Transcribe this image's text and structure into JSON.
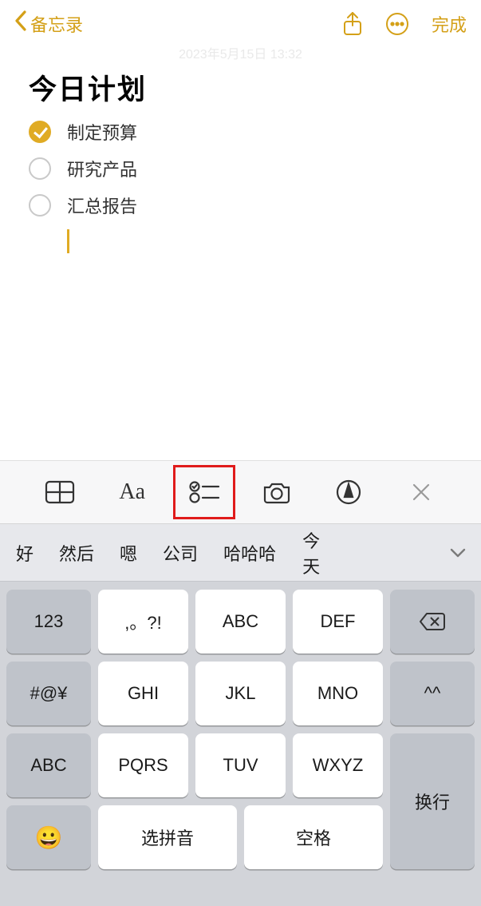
{
  "header": {
    "back_label": "备忘录",
    "done_label": "完成"
  },
  "timestamp": "2023年5月15日 13:32",
  "note": {
    "title": "今日计划",
    "items": [
      {
        "text": "制定预算",
        "checked": true
      },
      {
        "text": "研究产品",
        "checked": false
      },
      {
        "text": "汇总报告",
        "checked": false
      }
    ]
  },
  "format_bar": {
    "aa": "Aa"
  },
  "suggestions": [
    "好",
    "然后",
    "嗯",
    "公司",
    "哈哈哈",
    "今天"
  ],
  "keyboard": {
    "r1_side": "123",
    "r1": [
      ",。?!",
      "ABC",
      "DEF"
    ],
    "r2_side": "#@¥",
    "r2": [
      "GHI",
      "JKL",
      "MNO"
    ],
    "r3_side": "ABC",
    "r3": [
      "PQRS",
      "TUV",
      "WXYZ"
    ],
    "face": "^^",
    "emoji": "😀",
    "pinyin": "选拼音",
    "space": "空格",
    "return": "换行"
  }
}
